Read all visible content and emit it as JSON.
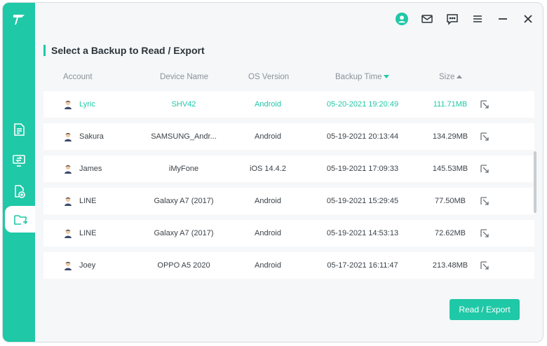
{
  "app": {
    "title": "Select a Backup to Read / Export"
  },
  "sidebar": {
    "logo_icon": "brand-logo-icon",
    "items": [
      {
        "icon": "file-list-icon",
        "active": false
      },
      {
        "icon": "device-transfer-icon",
        "active": false
      },
      {
        "icon": "file-add-icon",
        "active": false
      },
      {
        "icon": "folder-export-icon",
        "active": true
      }
    ]
  },
  "topbar": {
    "icons": [
      "user-icon",
      "mail-icon",
      "feedback-icon",
      "menu-icon",
      "minimize-icon",
      "close-icon"
    ]
  },
  "table": {
    "columns": {
      "account": "Account",
      "device": "Device Name",
      "os": "OS Version",
      "time": "Backup Time",
      "size": "Size"
    },
    "rows": [
      {
        "account": "Lyric",
        "device": "SHV42",
        "os": "Android",
        "time": "05-20-2021 19:20:49",
        "size": "111.71MB",
        "selected": true
      },
      {
        "account": "Sakura",
        "device": "SAMSUNG_Andr...",
        "os": "Android",
        "time": "05-19-2021 20:13:44",
        "size": "134.29MB",
        "selected": false
      },
      {
        "account": "James",
        "device": "iMyFone",
        "os": "iOS 14.4.2",
        "time": "05-19-2021 17:09:33",
        "size": "145.53MB",
        "selected": false
      },
      {
        "account": "LINE",
        "device": "Galaxy A7 (2017)",
        "os": "Android",
        "time": "05-19-2021 15:29:45",
        "size": "77.50MB",
        "selected": false
      },
      {
        "account": "LINE",
        "device": "Galaxy A7 (2017)",
        "os": "Android",
        "time": "05-19-2021 14:53:13",
        "size": "72.62MB",
        "selected": false
      },
      {
        "account": "Joey",
        "device": "OPPO A5 2020",
        "os": "Android",
        "time": "05-17-2021 16:11:47",
        "size": "213.48MB",
        "selected": false
      }
    ]
  },
  "footer": {
    "action_label": "Read / Export"
  },
  "colors": {
    "accent": "#1fc8a6",
    "text": "#3b4248",
    "muted": "#8b9299"
  }
}
